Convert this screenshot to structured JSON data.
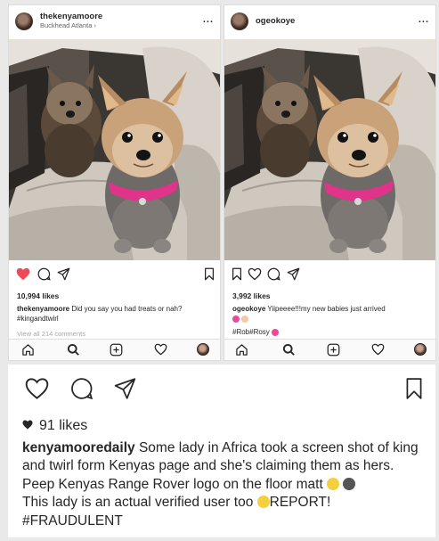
{
  "left_post": {
    "username": "thekenyamoore",
    "location": "Buckhead Atlanta ›",
    "more": "...",
    "likes": "10,994 likes",
    "caption_user": "thekenyamoore",
    "caption_text": " Did you say you had treats or nah?",
    "hashtag": "#kingandtwirl",
    "view_all": "View all 214 comments",
    "liked": true
  },
  "right_post": {
    "username": "ogeokoye",
    "more": "...",
    "likes": "3,992 likes",
    "caption_user": "ogeokoye",
    "caption_text": " Yiipeeee!!!my new babies just arrived",
    "hashtags": "#Rob#Rosy"
  },
  "bottom_post": {
    "likes": "91 likes",
    "caption_user": "kenyamooredaily",
    "caption_text_1": " Some lady in Africa took a screen shot of king and twirl form Kenyas page and she's claiming them as hers. Peep Kenyas Range Rover logo on the floor matt ",
    "caption_text_2": " This lady is an actual verified user too ",
    "caption_text_3": "REPORT!",
    "caption_text_4": "#FRAUDULENT"
  },
  "icons": {
    "like": "heart-icon",
    "comment": "comment-icon",
    "share": "send-icon",
    "save": "bookmark-icon",
    "home": "home-icon",
    "search": "search-icon",
    "add": "add-icon",
    "activity": "heart-outline-icon",
    "profile": "avatar"
  },
  "colors": {
    "liked_red": "#ed4956",
    "hashtag_blue": "#003569",
    "seat_leather": "#c9c2b8",
    "collar_pink": "#e0338a"
  }
}
